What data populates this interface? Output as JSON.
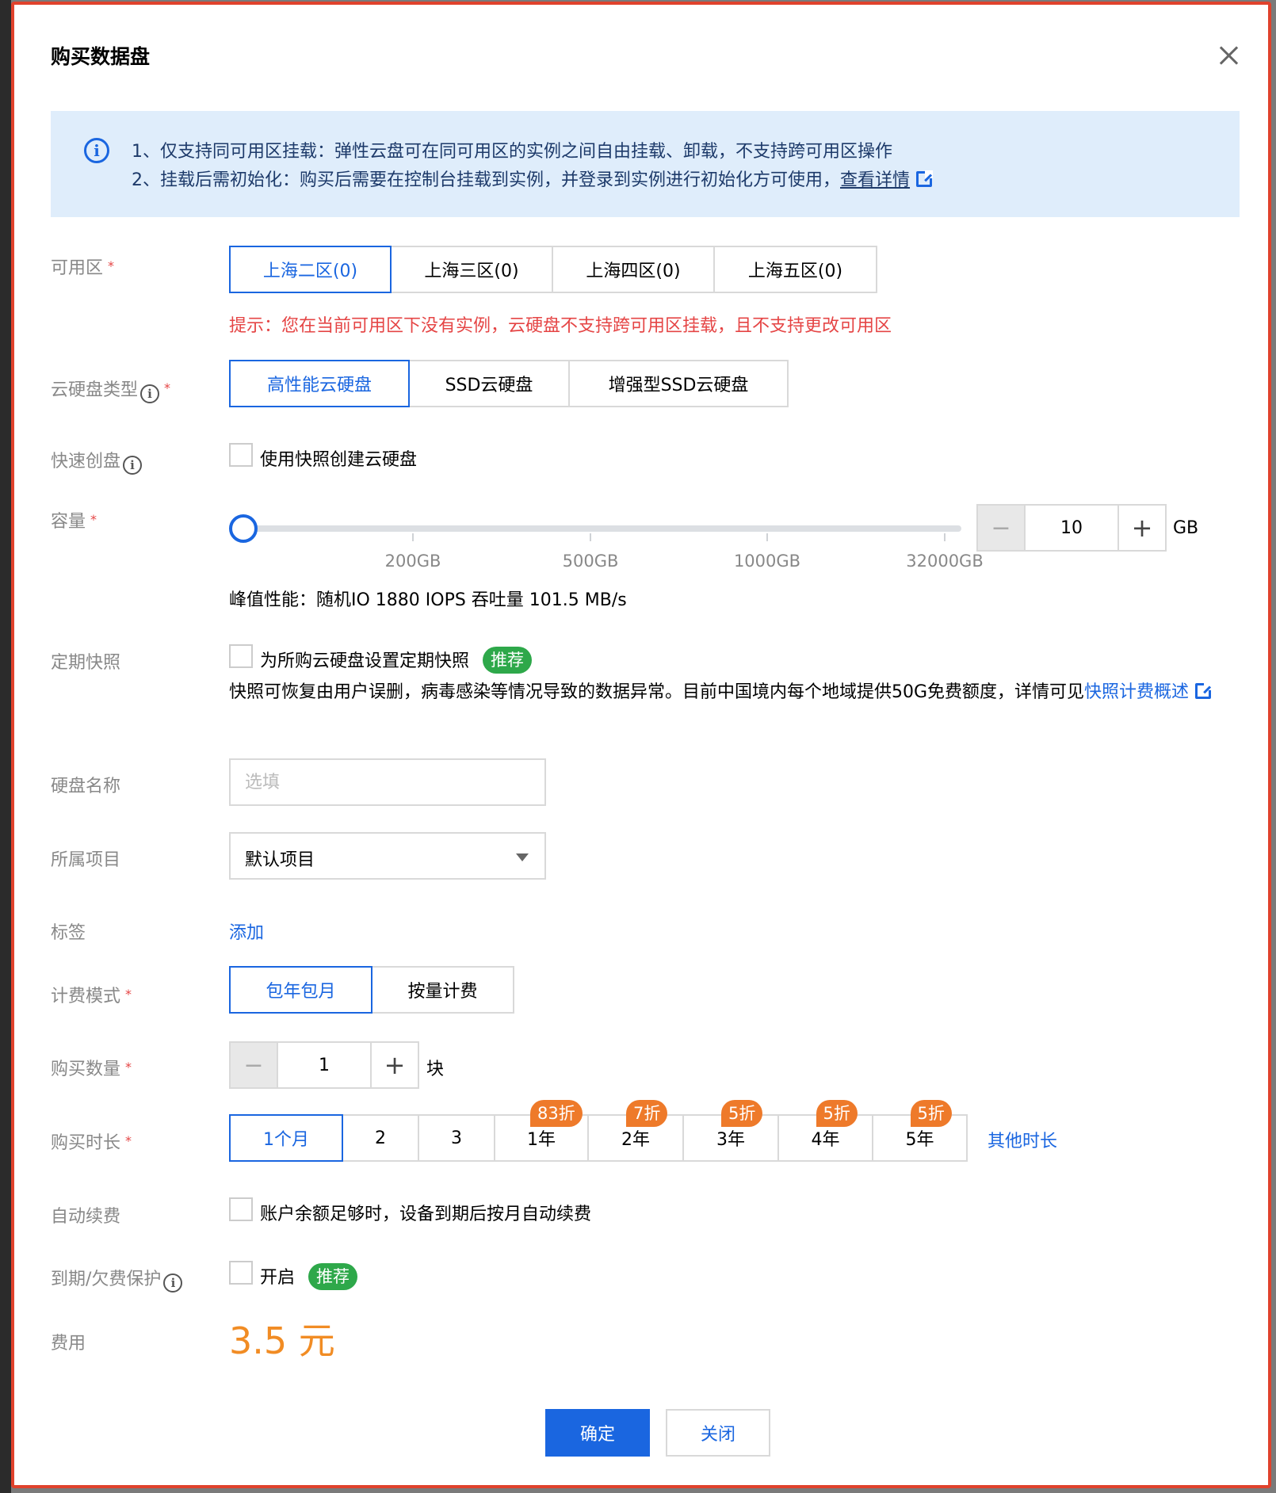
{
  "dialog": {
    "title": "购买数据盘"
  },
  "notice": {
    "line1": "1、仅支持同可用区挂载：弹性云盘可在同可用区的实例之间自由挂载、卸载，不支持跨可用区操作",
    "line2": "2、挂载后需初始化：购买后需要在控制台挂载到实例，并登录到实例进行初始化方可使用，",
    "link": "查看详情"
  },
  "zone": {
    "label": "可用区",
    "options": [
      "上海二区(0)",
      "上海三区(0)",
      "上海四区(0)",
      "上海五区(0)"
    ],
    "selected": "上海二区(0)",
    "tip": "提示：您在当前可用区下没有实例，云硬盘不支持跨可用区挂载，且不支持更改可用区"
  },
  "disk_type": {
    "label": "云硬盘类型",
    "options": [
      "高性能云硬盘",
      "SSD云硬盘",
      "增强型SSD云硬盘"
    ],
    "selected": "高性能云硬盘"
  },
  "quick_create": {
    "label": "快速创盘",
    "checkbox_label": "使用快照创建云硬盘"
  },
  "capacity": {
    "label": "容量",
    "marks": [
      "200GB",
      "500GB",
      "1000GB",
      "32000GB"
    ],
    "value": "10",
    "unit": "GB",
    "performance": "峰值性能：随机IO 1880 IOPS 吞吐量 101.5 MB/s"
  },
  "snapshot": {
    "label": "定期快照",
    "checkbox_label": "为所购云硬盘设置定期快照",
    "badge": "推荐",
    "desc": "快照可恢复由用户误删，病毒感染等情况导致的数据异常。目前中国境内每个地域提供50G免费额度，详情可见",
    "link": "快照计费概述"
  },
  "disk_name": {
    "label": "硬盘名称",
    "placeholder": "选填"
  },
  "project": {
    "label": "所属项目",
    "value": "默认项目"
  },
  "tags": {
    "label": "标签",
    "add": "添加"
  },
  "billing": {
    "label": "计费模式",
    "options": [
      "包年包月",
      "按量计费"
    ],
    "selected": "包年包月"
  },
  "quantity": {
    "label": "购买数量",
    "value": "1",
    "unit": "块"
  },
  "duration": {
    "label": "购买时长",
    "options": [
      {
        "label": "1个月",
        "discount": ""
      },
      {
        "label": "2",
        "discount": ""
      },
      {
        "label": "3",
        "discount": ""
      },
      {
        "label": "1年",
        "discount": "83折"
      },
      {
        "label": "2年",
        "discount": "7折"
      },
      {
        "label": "3年",
        "discount": "5折"
      },
      {
        "label": "4年",
        "discount": "5折"
      },
      {
        "label": "5年",
        "discount": "5折"
      }
    ],
    "selected": "1个月",
    "other": "其他时长"
  },
  "auto_renew": {
    "label": "自动续费",
    "checkbox_label": "账户余额足够时，设备到期后按月自动续费"
  },
  "protection": {
    "label": "到期/欠费保护",
    "checkbox_label": "开启",
    "badge": "推荐"
  },
  "fee": {
    "label": "费用",
    "value": "3.5 元"
  },
  "buttons": {
    "confirm": "确定",
    "close": "关闭"
  },
  "colors": {
    "primary": "#1a66e0",
    "danger": "#e54545",
    "price": "#f18c24",
    "badge_green": "#2ea84a",
    "badge_orange": "#ee7a2a",
    "notice_bg": "#dfedfb"
  }
}
